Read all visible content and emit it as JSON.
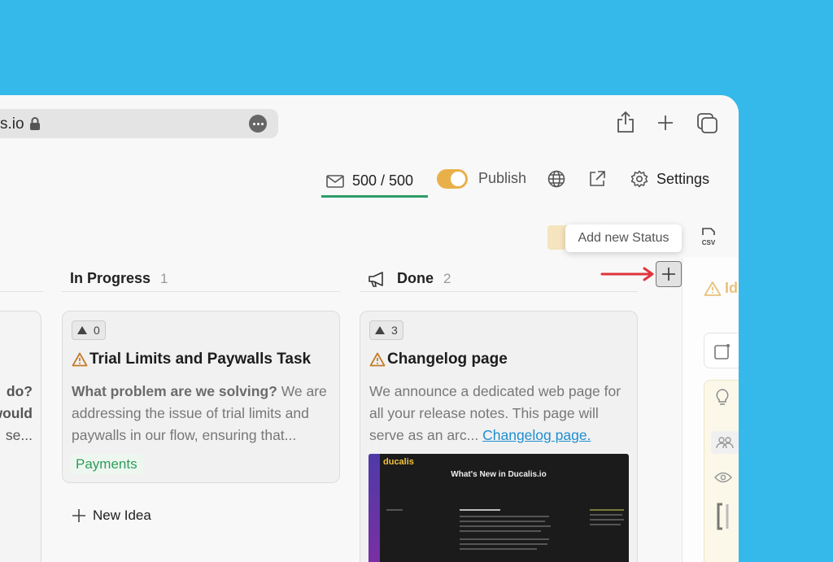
{
  "browser": {
    "url_text": "s.io"
  },
  "toolbar": {
    "mail_counter": "500 / 500",
    "publish_label": "Publish",
    "settings_label": "Settings",
    "add_status_tooltip": "Add new Status",
    "export_label": "CSV"
  },
  "columns": [
    {
      "title": "In Progress",
      "count": "1",
      "cards": [
        {
          "votes": "0",
          "title": "Trial Limits and Paywalls Task",
          "description_bold": "What problem are we solving?",
          "description": " We are addressing the issue of trial limits and paywalls in our flow, ensuring that...",
          "tag": "Payments"
        }
      ],
      "new_idea_label": "New Idea"
    },
    {
      "title": "Done",
      "count": "2",
      "cards": [
        {
          "votes": "3",
          "title": "Changelog page",
          "description": "We announce a dedicated web page for all your release notes. This page will serve as an arc...",
          "link": "Changelog page.",
          "thumbnail": {
            "brand": "ducalis",
            "heading": "What's New in Ducalis.io"
          }
        }
      ]
    }
  ],
  "left_column_fragments": [
    "do?",
    "would",
    "se..."
  ],
  "right_panel": {
    "status_fragment": "Id"
  },
  "colors": {
    "background": "#35b9ea",
    "accent_green": "#2e9c68",
    "toggle_on": "#e9b04a",
    "warning": "#c47b2a",
    "link": "#1e8fd0",
    "arrow": "#e0353d"
  }
}
